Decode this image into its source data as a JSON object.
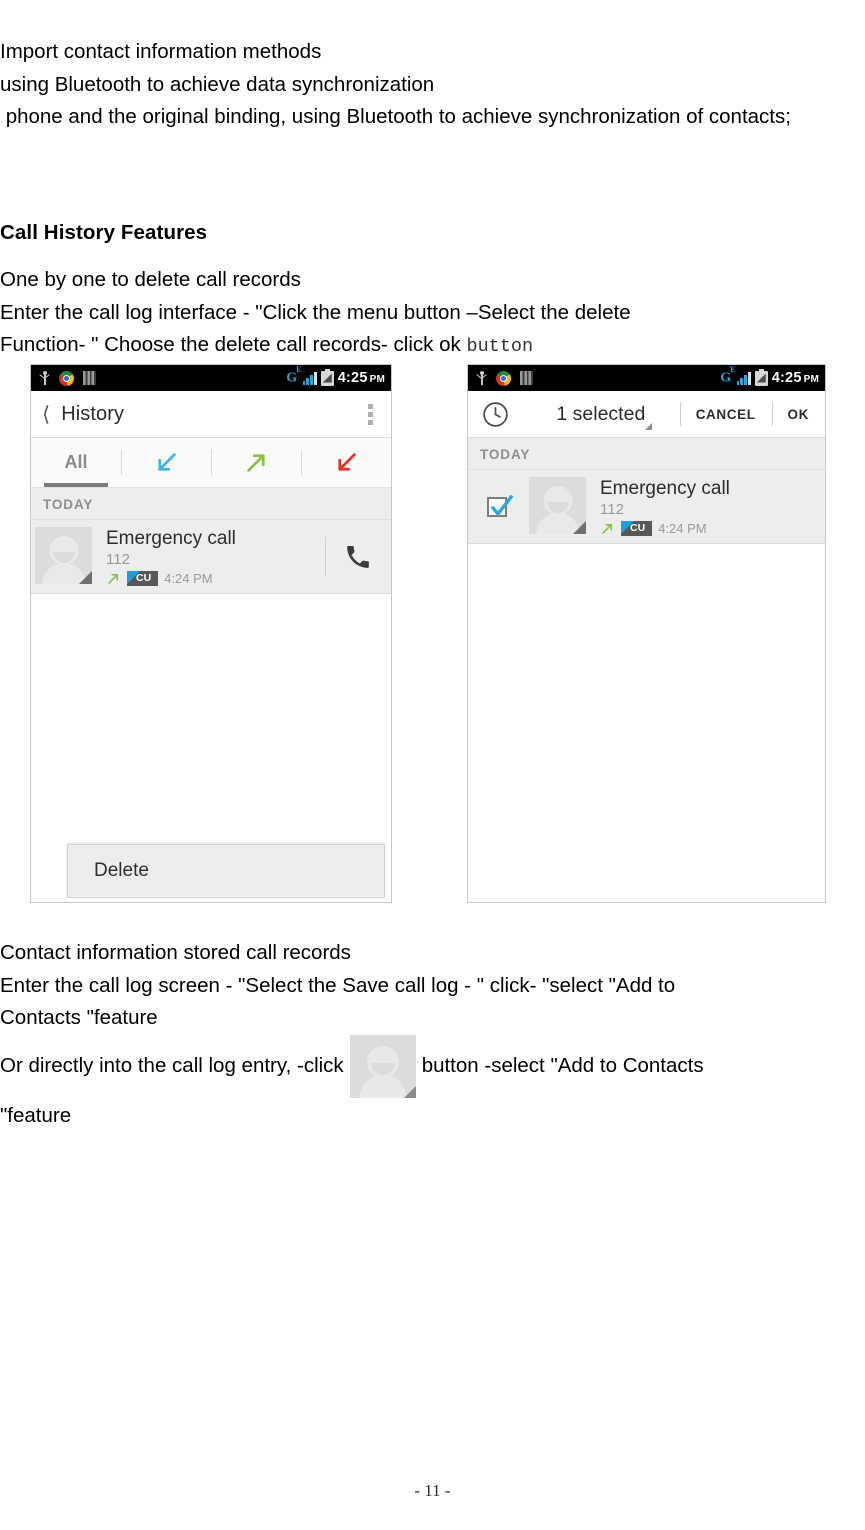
{
  "document": {
    "intro_lines": [
      "Import contact information methods",
      "using Bluetooth to achieve data synchronization",
      " phone and the original binding, using Bluetooth to achieve synchronization of contacts;"
    ],
    "heading": "Call History Features",
    "para2_lines": [
      "One by one to delete call records",
      "Enter the call log interface - \"Click the menu button –Select the delete",
      "Function- \" Choose the delete call records- click ok "
    ],
    "para2_mono": "button",
    "para3_lines": [
      "Contact information stored call records",
      "Enter the call log screen - \"Select the Save call log - \" click- \"select \"Add to",
      "Contacts \"feature"
    ],
    "para4_prefix": "Or directly into the call log entry, -click",
    "para4_suffix": "button -select \"Add to Contacts",
    "para4_tail": "\"feature",
    "page_number": "- 11 -"
  },
  "screenshot_left": {
    "statusbar": {
      "usb_icon": "usb-icon",
      "chrome_icon": "chrome-icon",
      "bars_icon": "signal-bars-icon",
      "network_label": "G",
      "network_sup": "E",
      "signal_icon": "signal-strength-icon",
      "battery_icon": "battery-icon",
      "time": "4:25",
      "ampm": "PM"
    },
    "actionbar": {
      "back_icon": "back-chevron-icon",
      "title": "History",
      "overflow_icon": "overflow-menu-icon"
    },
    "tabs": [
      {
        "label": "All",
        "type": "text",
        "selected": true
      },
      {
        "label": "",
        "type": "incoming",
        "color": "#40b4e5",
        "selected": false
      },
      {
        "label": "",
        "type": "outgoing",
        "color": "#85c440",
        "selected": false
      },
      {
        "label": "",
        "type": "missed",
        "color": "#e63329",
        "selected": false
      }
    ],
    "section_header": "TODAY",
    "call": {
      "name": "Emergency call",
      "number": "112",
      "direction_icon": "outgoing-arrow-icon",
      "sim_badge": "CU",
      "time": "4:24 PM",
      "action_icon": "phone-handset-icon"
    },
    "popup": {
      "delete_label": "Delete"
    }
  },
  "screenshot_right": {
    "statusbar": {
      "usb_icon": "usb-icon",
      "chrome_icon": "chrome-icon",
      "bars_icon": "signal-bars-icon",
      "network_label": "G",
      "network_sup": "E",
      "signal_icon": "signal-strength-icon",
      "battery_icon": "battery-icon",
      "time": "4:25",
      "ampm": "PM"
    },
    "actionbar": {
      "clock_icon": "clock-icon",
      "selection_text": "1 selected",
      "caret_icon": "dropdown-caret-icon",
      "cancel_label": "CANCEL",
      "ok_label": "OK"
    },
    "section_header": "TODAY",
    "call": {
      "checked": true,
      "name": "Emergency call",
      "number": "112",
      "direction_icon": "outgoing-arrow-icon",
      "sim_badge": "CU",
      "time": "4:24 PM"
    }
  },
  "colors": {
    "incoming": "#40b4e5",
    "outgoing": "#85c440",
    "missed": "#e63329",
    "sim_blue": "#1a9fe0",
    "status_bar": "#000000",
    "checkbox_blue": "#26a7e0"
  }
}
